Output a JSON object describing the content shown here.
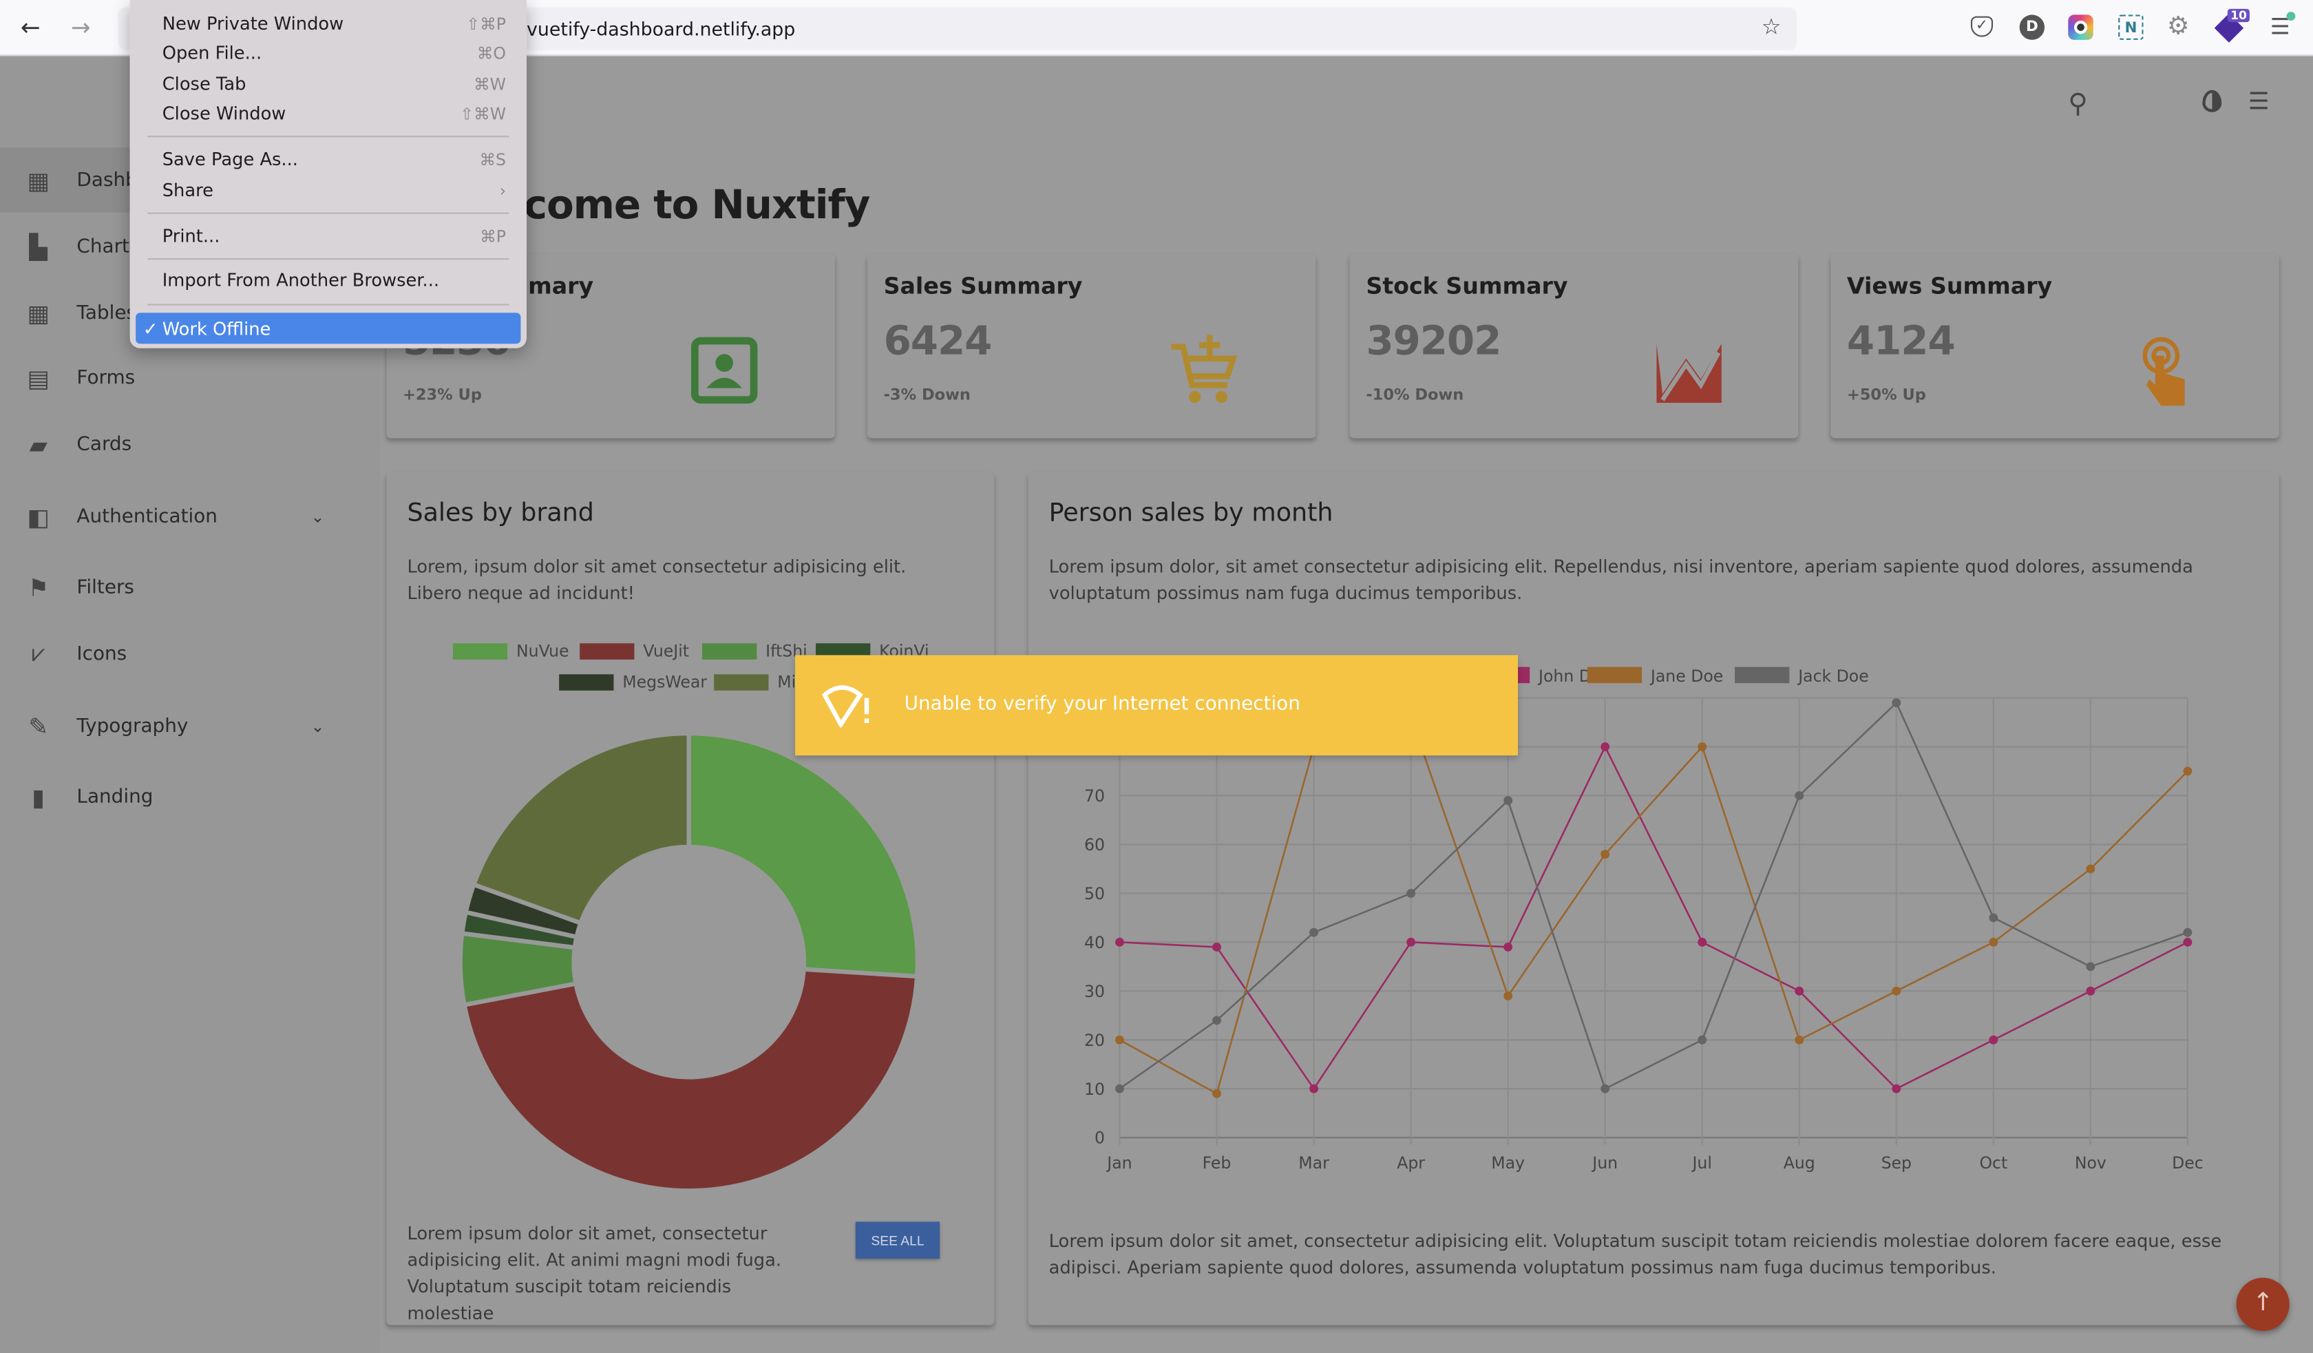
{
  "browser": {
    "url": "vuetify-dashboard.netlify.app",
    "badge": "10"
  },
  "file_menu": {
    "items": [
      {
        "label": "New Private Window",
        "shortcut": "⇧⌘P"
      },
      {
        "label": "Open File...",
        "shortcut": "⌘O"
      },
      {
        "label": "Close Tab",
        "shortcut": "⌘W"
      },
      {
        "label": "Close Window",
        "shortcut": "⇧⌘W"
      },
      {
        "label": "Save Page As...",
        "shortcut": "⌘S"
      },
      {
        "label": "Share",
        "shortcut": "›"
      },
      {
        "label": "Print...",
        "shortcut": "⌘P"
      },
      {
        "label": "Import From Another Browser...",
        "shortcut": ""
      },
      {
        "label": "Work Offline",
        "shortcut": "",
        "checked": true
      }
    ]
  },
  "sidebar": {
    "items": [
      {
        "label": "Dashboard",
        "icon": "grid-icon"
      },
      {
        "label": "Charts",
        "icon": "bar-chart-icon"
      },
      {
        "label": "Tables",
        "icon": "table-icon"
      },
      {
        "label": "Forms",
        "icon": "forms-icon"
      },
      {
        "label": "Cards",
        "icon": "cards-icon"
      },
      {
        "label": "Authentication",
        "icon": "user-card-icon"
      },
      {
        "label": "Filters",
        "icon": "flag-icon"
      },
      {
        "label": "Icons",
        "icon": "icons-icon"
      },
      {
        "label": "Typography",
        "icon": "edit-icon"
      },
      {
        "label": "Landing",
        "icon": "book-icon"
      }
    ]
  },
  "header": {
    "title": "come to Nuxtify"
  },
  "cards": [
    {
      "title": "mary",
      "value": "5230",
      "sub": "+23% Up",
      "icon": "account-box-icon",
      "color": "#3f7a3a"
    },
    {
      "title": "Sales Summary",
      "value": "6424",
      "sub": "-3% Down",
      "icon": "cart-plus-icon",
      "color": "#b08a2e"
    },
    {
      "title": "Stock Summary",
      "value": "39202",
      "sub": "-10% Down",
      "icon": "chart-line-icon",
      "color": "#9c3b30"
    },
    {
      "title": "Views Summary",
      "value": "4124",
      "sub": "+50% Up",
      "icon": "touch-icon",
      "color": "#b87424"
    }
  ],
  "brand": {
    "title": "Sales by brand",
    "desc": "Lorem, ipsum dolor sit amet consectetur adipisicing elit. Libero neque ad incidunt!",
    "footer": "Lorem ipsum dolor sit amet, consectetur adipisicing elit. At animi magni modi fuga. Voluptatum suscipit totam reiciendis molestiae",
    "button": "SEE ALL"
  },
  "person": {
    "title": "Person sales by month",
    "desc": "Lorem ipsum dolor, sit amet consectetur adipisicing elit. Repellendus, nisi inventore, aperiam sapiente quod dolores, assumenda voluptatum possimus nam fuga ducimus temporibus.",
    "footer": "Lorem ipsum dolor sit amet, consectetur adipisicing elit. Voluptatum suscipit totam reiciendis molestiae dolorem facere eaque, esse adipisci. Aperiam sapiente quod dolores, assumenda voluptatum possimus nam fuga ducimus temporibus."
  },
  "toast": {
    "text": "Unable to verify your Internet connection",
    "icon": "wifi-alert-icon",
    "color": "#f5c445"
  },
  "chart_data": [
    {
      "type": "pie",
      "donut": true,
      "categories": [
        "NuVue",
        "VueJit",
        "IftShi",
        "KoinVi",
        "MegsWear",
        "Mi"
      ],
      "values": [
        26,
        46,
        5,
        1.5,
        2,
        19.5
      ],
      "colors": [
        "#5b9a48",
        "#793431",
        "#528a42",
        "#33502e",
        "#2f3b28",
        "#5f6b3a"
      ]
    },
    {
      "type": "line",
      "categories": [
        "Jan",
        "Feb",
        "Mar",
        "Apr",
        "May",
        "Jun",
        "Jul",
        "Aug",
        "Sep",
        "Oct",
        "Nov",
        "Dec"
      ],
      "ylim": [
        0,
        90
      ],
      "yticks": [
        0,
        10,
        20,
        30,
        40,
        50,
        60,
        70
      ],
      "grid": true,
      "legend": "top",
      "series": [
        {
          "name": "John Doe",
          "color": "#9c2a62",
          "values": [
            40,
            39,
            10,
            40,
            39,
            80,
            40,
            30,
            10,
            20,
            30,
            40
          ]
        },
        {
          "name": "Jane Doe",
          "color": "#9a662c",
          "values": [
            20,
            9,
            80,
            86,
            29,
            58,
            80,
            20,
            30,
            40,
            55,
            75
          ]
        },
        {
          "name": "Jack Doe",
          "color": "#656565",
          "values": [
            10,
            24,
            42,
            50,
            69,
            10,
            20,
            70,
            89,
            45,
            35,
            42
          ]
        }
      ]
    }
  ]
}
